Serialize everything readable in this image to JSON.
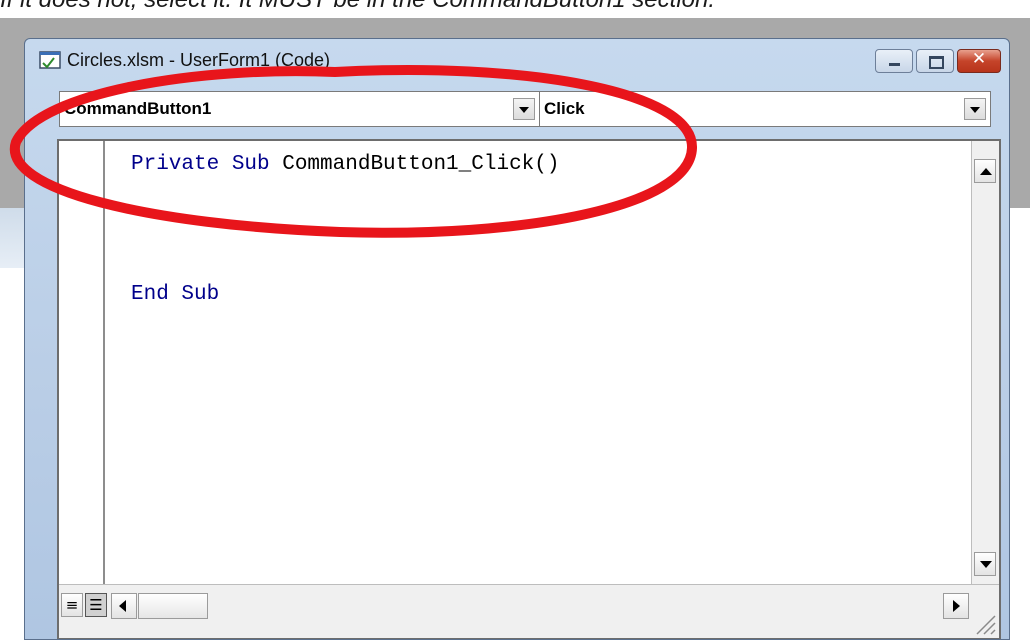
{
  "caption": "If it does not, select it. It MUST be in the CommandButton1 section.",
  "window": {
    "title": "Circles.xlsm - UserForm1 (Code)",
    "icon": "code-window-icon",
    "controls": [
      "minimize",
      "maximize",
      "close"
    ]
  },
  "object_combo": {
    "value": "CommandButton1"
  },
  "procedure_combo": {
    "value": "Click"
  },
  "code": {
    "line1_keywords": "Private Sub",
    "line1_name": " CommandButton1_Click()",
    "line2": "End Sub"
  },
  "annotation": {
    "shape": "ellipse",
    "color": "#e8151b"
  },
  "colors": {
    "keyword": "#00008b",
    "window_frame": "#b9cde6",
    "close_button": "#c5442a"
  }
}
